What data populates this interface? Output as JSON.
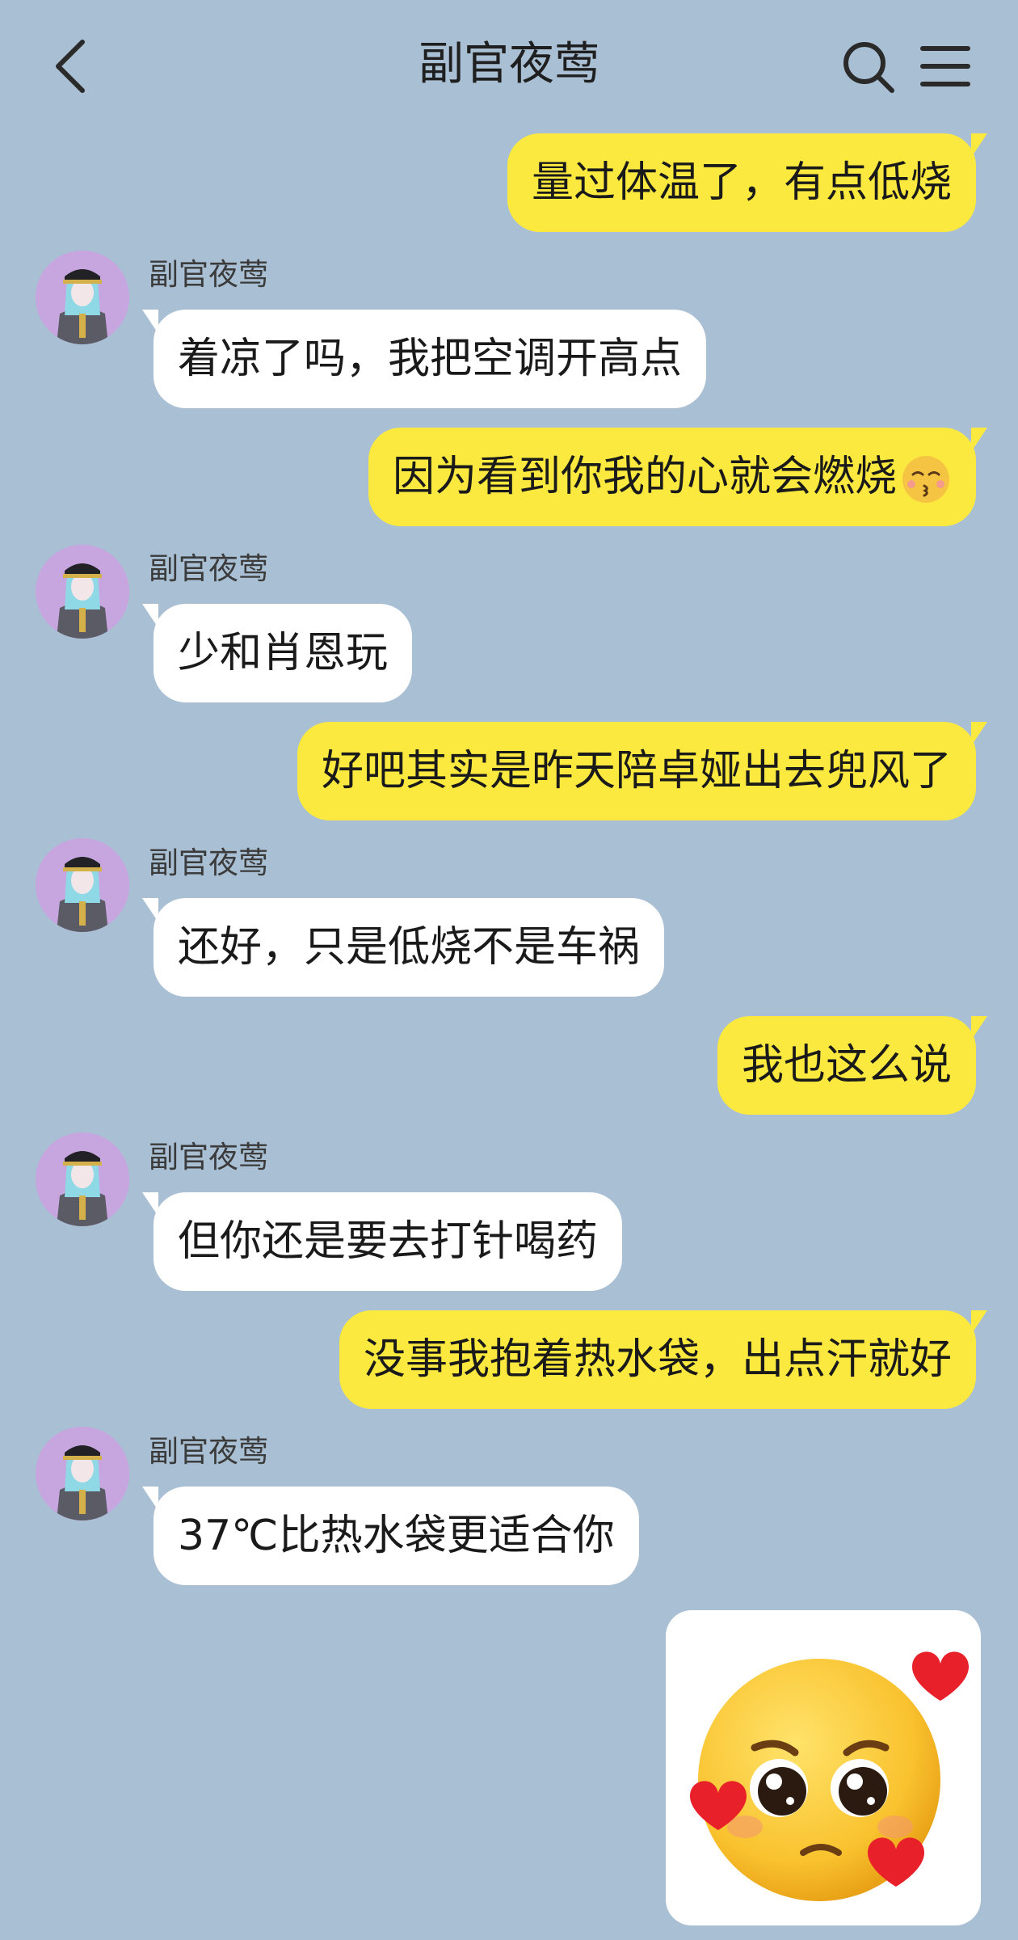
{
  "header": {
    "title": "副官夜莺",
    "back_icon": "chevron-left-icon",
    "search_icon": "search-icon",
    "menu_icon": "hamburger-menu-icon"
  },
  "colors": {
    "background": "#a9bfd3",
    "outgoing_bubble": "#fce93f",
    "incoming_bubble": "#ffffff",
    "avatar_bg": "#c7a6e0"
  },
  "messages": [
    {
      "direction": "outgoing",
      "text": "量过体温了，有点低烧"
    },
    {
      "direction": "incoming",
      "sender": "副官夜莺",
      "text": "着凉了吗，我把空调开高点"
    },
    {
      "direction": "outgoing",
      "text": "因为看到你我的心就会燃烧",
      "emoji": "kissing-face-icon"
    },
    {
      "direction": "incoming",
      "sender": "副官夜莺",
      "text": "少和肖恩玩"
    },
    {
      "direction": "outgoing",
      "text": "好吧其实是昨天陪卓娅出去兜风了"
    },
    {
      "direction": "incoming",
      "sender": "副官夜莺",
      "text": "还好，只是低烧不是车祸"
    },
    {
      "direction": "outgoing",
      "text": "我也这么说"
    },
    {
      "direction": "incoming",
      "sender": "副官夜莺",
      "text": "但你还是要去打针喝药"
    },
    {
      "direction": "outgoing",
      "text": "没事我抱着热水袋，出点汗就好"
    },
    {
      "direction": "incoming",
      "sender": "副官夜莺",
      "text": "37℃比热水袋更适合你"
    },
    {
      "direction": "outgoing",
      "type": "sticker",
      "sticker": "pleading-face-with-hearts-sticker"
    }
  ]
}
